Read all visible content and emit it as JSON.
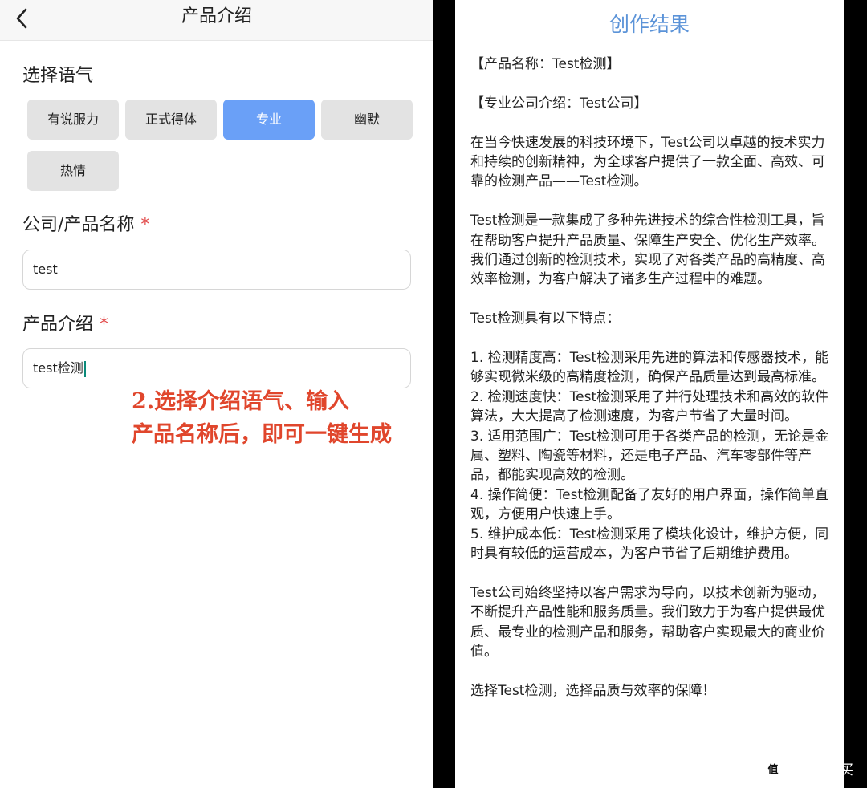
{
  "left": {
    "nav_title": "产品介绍",
    "back_icon": "chevron-left-icon",
    "tone_label": "选择语气",
    "tones": [
      "有说服力",
      "正式得体",
      "专业",
      "幽默",
      "热情"
    ],
    "selected_tone": "专业",
    "name_label": "公司/产品名称",
    "name_value": "test",
    "intro_label": "产品介绍",
    "intro_value": "test检测",
    "required_mark": "*",
    "annotation_line1": "2.选择介绍语气、输入",
    "annotation_line2": "产品名称后，即可一键生成"
  },
  "right": {
    "title": "创作结果",
    "paragraphs": [
      "【产品名称：Test检测】",
      "",
      "【专业公司介绍：Test公司】",
      "",
      "在当今快速发展的科技环境下，Test公司以卓越的技术实力和持续的创新精神，为全球客户提供了一款全面、高效、可靠的检测产品——Test检测。",
      "",
      "Test检测是一款集成了多种先进技术的综合性检测工具，旨在帮助客户提升产品质量、保障生产安全、优化生产效率。我们通过创新的检测技术，实现了对各类产品的高精度、高效率检测，为客户解决了诸多生产过程中的难题。",
      "",
      "Test检测具有以下特点：",
      "",
      "1. 检测精度高：Test检测采用先进的算法和传感器技术，能够实现微米级的高精度检测，确保产品质量达到最高标准。",
      "2. 检测速度快：Test检测采用了并行处理技术和高效的软件算法，大大提高了检测速度，为客户节省了大量时间。",
      "3. 适用范围广：Test检测可用于各类产品的检测，无论是金属、塑料、陶瓷等材料，还是电子产品、汽车零部件等产品，都能实现高效的检测。",
      "4. 操作简便：Test检测配备了友好的用户界面，操作简单直观，方便用户快速上手。",
      "5. 维护成本低：Test检测采用了模块化设计，维护方便，同时具有较低的运营成本，为客户节省了后期维护费用。",
      "",
      "Test公司始终坚持以客户需求为导向，以技术创新为驱动，不断提升产品性能和服务质量。我们致力于为客户提供最优质、最专业的检测产品和服务，帮助客户实现最大的商业价值。",
      "",
      "选择Test检测，选择品质与效率的保障！"
    ]
  },
  "watermark": {
    "icon_text": "值",
    "text": "什么值得买"
  },
  "colors": {
    "accent": "#6aa0f7",
    "title_blue": "#5b93d8",
    "annotation_red": "#e0462c",
    "required_red": "#e24b4b",
    "chip_bg": "#e3e3e3"
  }
}
